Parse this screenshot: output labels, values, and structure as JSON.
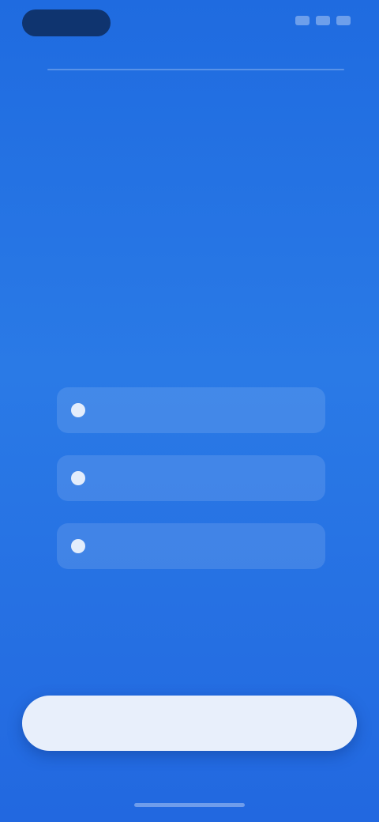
{
  "status_bar": {
    "time": ""
  },
  "header": {
    "title": ""
  },
  "headline": {
    "text": ""
  },
  "options": [
    {
      "label": "",
      "icon": "bullet-icon"
    },
    {
      "label": "",
      "icon": "bullet-icon"
    },
    {
      "label": "",
      "icon": "bullet-icon"
    }
  ],
  "cta": {
    "label": ""
  },
  "colors": {
    "background_top": "#1f6be0",
    "background_bottom": "#2268e0",
    "button_bg": "#e8effb",
    "button_text": "#2a5fbf"
  }
}
